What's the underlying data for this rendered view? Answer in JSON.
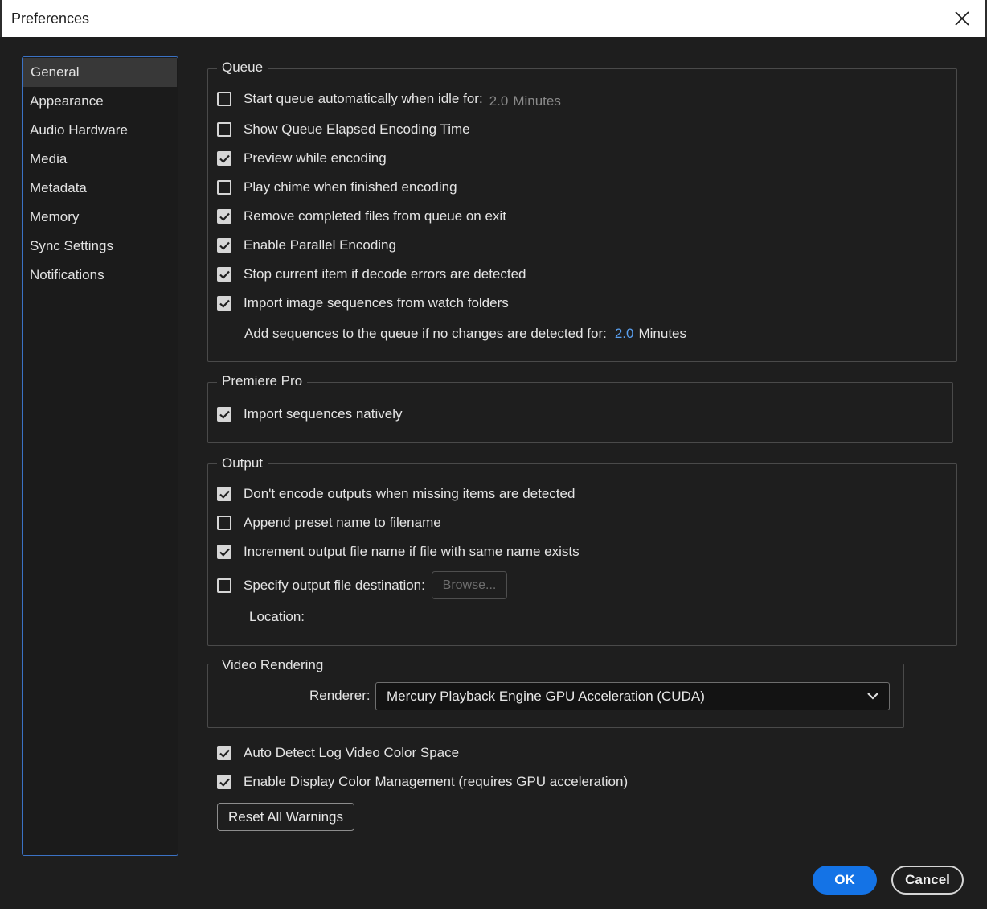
{
  "window": {
    "title": "Preferences"
  },
  "sidebar": {
    "items": [
      {
        "label": "General",
        "selected": true
      },
      {
        "label": "Appearance"
      },
      {
        "label": "Audio Hardware"
      },
      {
        "label": "Media"
      },
      {
        "label": "Metadata"
      },
      {
        "label": "Memory"
      },
      {
        "label": "Sync Settings"
      },
      {
        "label": "Notifications"
      }
    ]
  },
  "queue": {
    "label": "Queue",
    "start_auto": {
      "label": "Start queue automatically when idle for:",
      "checked": false,
      "value": "2.0",
      "unit": "Minutes"
    },
    "show_elapsed": {
      "label": "Show Queue Elapsed Encoding Time",
      "checked": false
    },
    "preview_encoding": {
      "label": "Preview while encoding",
      "checked": true
    },
    "play_chime": {
      "label": "Play chime when finished encoding",
      "checked": false
    },
    "remove_completed": {
      "label": "Remove completed files from queue on exit",
      "checked": true
    },
    "parallel": {
      "label": "Enable Parallel Encoding",
      "checked": true
    },
    "stop_decode": {
      "label": "Stop current item if decode errors are detected",
      "checked": true
    },
    "import_seq": {
      "label": "Import image sequences from watch folders",
      "checked": true
    },
    "add_seq": {
      "label": "Add sequences to the queue if no changes are detected for:",
      "value": "2.0",
      "unit": "Minutes"
    }
  },
  "premiere": {
    "label": "Premiere Pro",
    "import_native": {
      "label": "Import sequences natively",
      "checked": true
    }
  },
  "output": {
    "label": "Output",
    "dont_encode": {
      "label": "Don't encode outputs when missing items are detected",
      "checked": true
    },
    "append_preset": {
      "label": "Append preset name to filename",
      "checked": false
    },
    "increment": {
      "label": "Increment output file name if file with same name exists",
      "checked": true
    },
    "specify_dest": {
      "label": "Specify output file destination:",
      "checked": false
    },
    "browse": "Browse...",
    "location": "Location:"
  },
  "video_rendering": {
    "label": "Video Rendering",
    "renderer_label": "Renderer:",
    "renderer_value": "Mercury Playback Engine GPU Acceleration (CUDA)"
  },
  "misc": {
    "auto_detect": {
      "label": "Auto Detect Log Video Color Space",
      "checked": true
    },
    "display_color": {
      "label": "Enable Display Color Management (requires GPU acceleration)",
      "checked": true
    },
    "reset_warnings": "Reset All Warnings"
  },
  "footer": {
    "ok": "OK",
    "cancel": "Cancel"
  },
  "colors": {
    "accent": "#1473e6",
    "selection_border": "#3b72c4",
    "value_blue": "#5aa0f0"
  }
}
